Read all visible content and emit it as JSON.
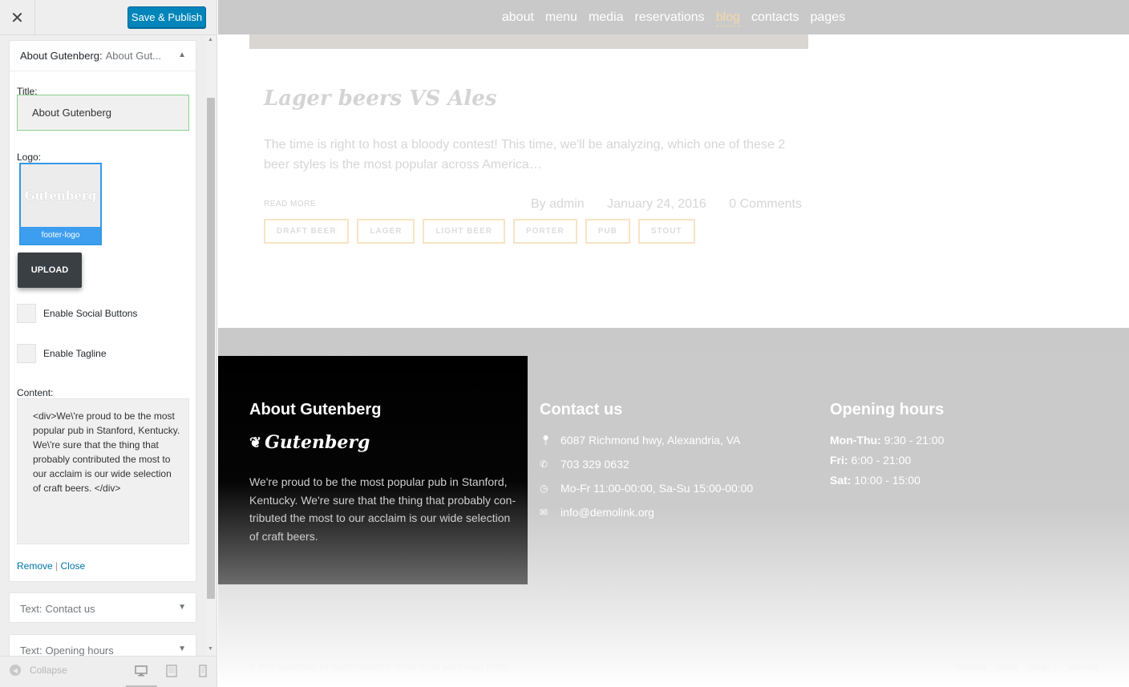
{
  "customizer": {
    "save_label": "Save & Publish",
    "widget_about": {
      "type": "About Gutenberg:",
      "name": "About Gut...",
      "title_label": "Title:",
      "title_value": "About Gutenberg",
      "logo_label": "Logo:",
      "logo_thumb_text": "Gutenberg",
      "logo_caption": "footer-logo",
      "upload_label": "UPLOAD",
      "social_label": "Enable Social Buttons",
      "tagline_label": "Enable Tagline",
      "content_label": "Content:",
      "content_value": "<div>We\\'re proud to be the most popular pub in Stanford, Kentucky. We\\'re sure that the thing that probably contributed the most to our acclaim is our wide selection of craft beers. </div>",
      "remove_label": "Remove",
      "separator": "|",
      "close_label": "Close"
    },
    "widget_contact": {
      "type": "Text:",
      "name": "Contact us"
    },
    "widget_opening": {
      "type": "Text:",
      "name": "Opening hours"
    },
    "collapse_label": "Collapse"
  },
  "preview": {
    "nav": [
      "about",
      "menu",
      "media",
      "reservations",
      "blog",
      "contacts",
      "pages"
    ],
    "post": {
      "title": "Lager beers VS Ales",
      "excerpt": "The time is right to host a bloody contest! This time, we'll be analyzing, which one of these 2 beer styles is the most popular across America…",
      "read_more": "READ MORE",
      "author": "By admin",
      "date": "January 24, 2016",
      "comments": "0 Comments",
      "tags": [
        "DRAFT BEER",
        "LAGER",
        "LIGHT BEER",
        "PORTER",
        "PUB",
        "STOUT"
      ]
    },
    "footer": {
      "about_title": "About Gutenberg",
      "logo_text": "Gutenberg",
      "about_text": "We're proud to be the most popular pub in Stanford, Kentucky. We're sure that the thing that probably con-tributed the most to our acclaim is our wide selection of craft beers.",
      "contact_title": "Contact us",
      "address": "6087 Richmond hwy, Alexandria, VA",
      "phone": "703 329 0632",
      "hours_line": "Mo-Fr 11:00-00:00, Sa-Su 15:00-00:00",
      "email": "info@demolink.org",
      "hours_title": "Opening hours",
      "hours": [
        {
          "day": "Mon-Thu:",
          "time": "9:30 - 21:00"
        },
        {
          "day": "Fri:",
          "time": "6:00 - 21:00"
        },
        {
          "day": "Sat:",
          "time": "10:00 - 15:00"
        }
      ],
      "copyright": "© 2016 Gutenberg. All Rights Reserved. Terms of use and Privacy Policy",
      "social": [
        "facebook",
        "twitter",
        "google +",
        "pinterest"
      ]
    }
  },
  "colors": {
    "accent": "#0085ba",
    "link": "#0073aa",
    "nav_active": "#f5d8a8"
  }
}
